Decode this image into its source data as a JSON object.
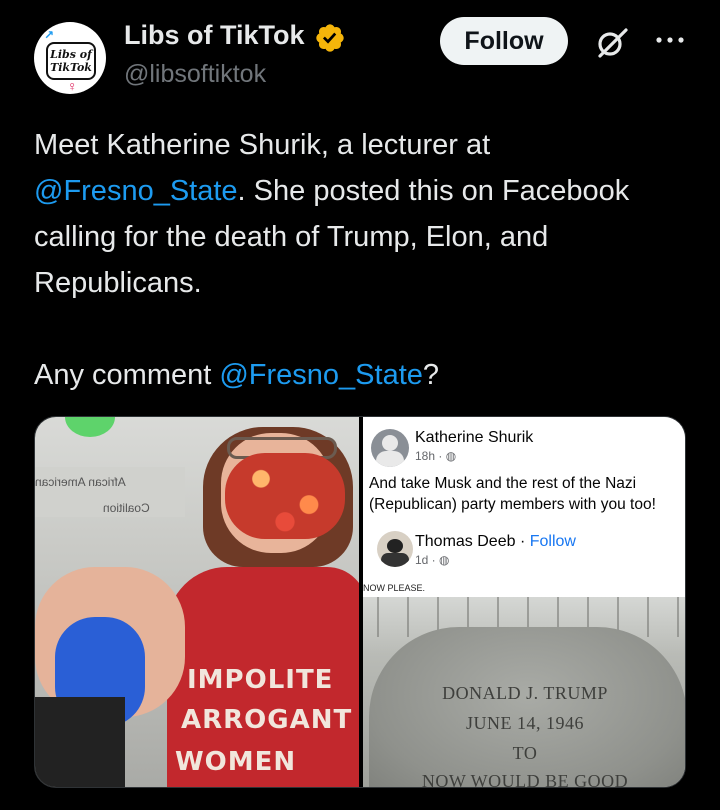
{
  "author": {
    "name": "Libs of TikTok",
    "handle": "@libsoftiktok",
    "avatar_text_line1": "Libs of",
    "avatar_text_line2": "TikTok",
    "verified_icon": "verified-badge-icon",
    "verified_color": "#f5b50a"
  },
  "actions": {
    "follow_label": "Follow",
    "grok_icon": "grok-icon",
    "more_icon": "more-icon"
  },
  "tweet": {
    "line1": "Meet Katherine Shurik, a lecturer at",
    "mention1": "@Fresno_State",
    "line2_rest": ". She posted this on Facebook",
    "line3": "calling for the death of Trump, Elon, and",
    "line4": "Republicans.",
    "line6_start": "Any comment ",
    "mention2": "@Fresno_State",
    "line6_end": "?"
  },
  "media": {
    "left_photo": {
      "sign_line1": "African American",
      "sign_line2": "Coalition",
      "shirt_line1": "IMPOLITE",
      "shirt_line2": "ARROGANT",
      "shirt_line3": "WOMEN"
    },
    "right_screenshot": {
      "poster_name": "Katherine Shurik",
      "poster_meta": "18h · ",
      "post_text": "And take Musk and the rest of the Nazi (Republican) party members with you too!",
      "commenter_name": "Thomas Deeb",
      "commenter_follow": "Follow",
      "commenter_separator": " · ",
      "commenter_meta": "1d · ",
      "image_caption": "NOW PLEASE.",
      "epitaph_line1": "DONALD J. TRUMP",
      "epitaph_line2": "JUNE 14, 1946",
      "epitaph_line3": "TO",
      "epitaph_line4": "NOW WOULD BE GOOD"
    }
  },
  "colors": {
    "background": "#000000",
    "text": "#e7e9ea",
    "secondary": "#71767b",
    "link": "#1d9bf0",
    "button_bg": "#eff3f4"
  }
}
